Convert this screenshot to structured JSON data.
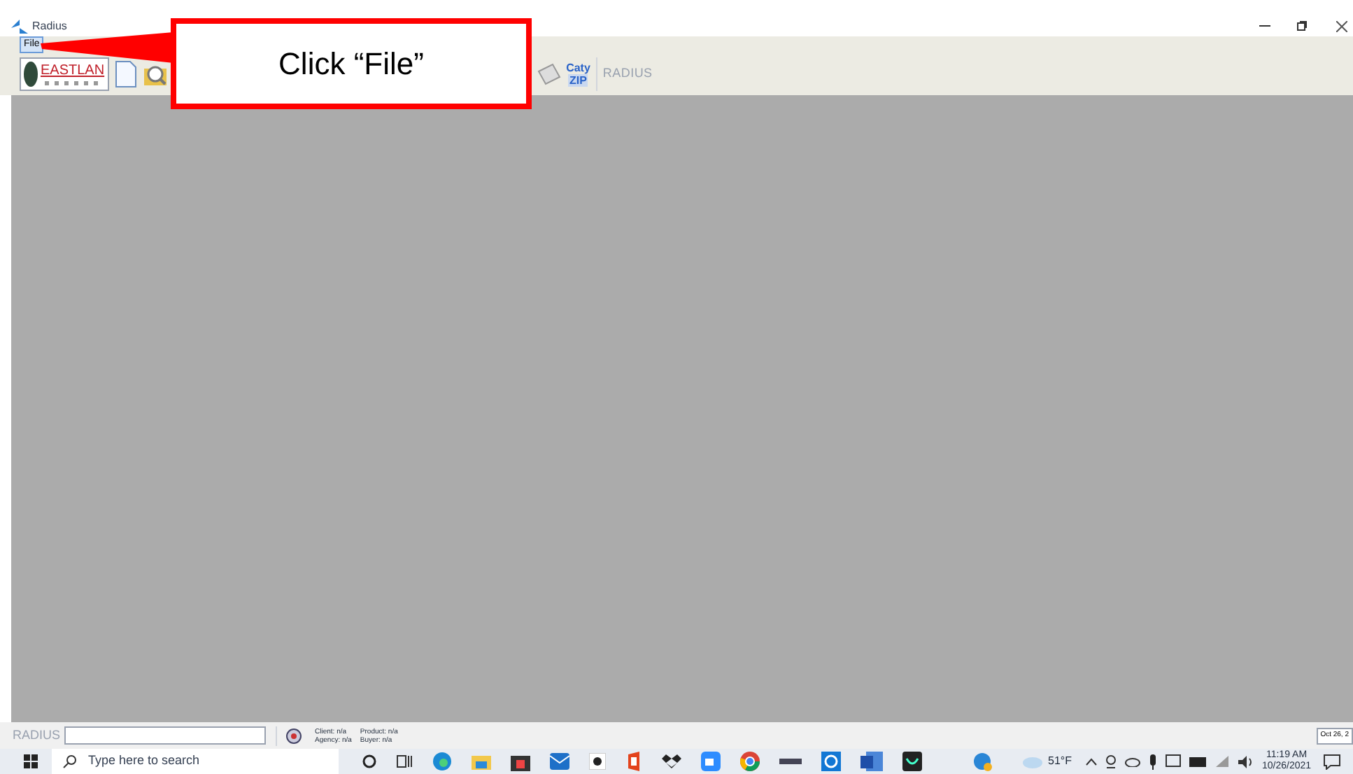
{
  "window": {
    "title": "Radius"
  },
  "menu": [
    {
      "label": "File",
      "selected": true
    }
  ],
  "toolbar": {
    "company_logo": "EASTLAN",
    "zip_button": [
      "Caty",
      "ZIP"
    ],
    "brand_logo": "RADIUS"
  },
  "callout": {
    "text": "Click “File”"
  },
  "status_bar": {
    "brand_logo": "RADIUS",
    "fields": [
      {
        "label": "Client: n/a"
      },
      {
        "label": "Product: n/a"
      },
      {
        "label": "Agency: n/a"
      },
      {
        "label": "Buyer: n/a"
      }
    ],
    "date": "Oct 26, 2"
  },
  "taskbar": {
    "search_placeholder": "Type here to search",
    "weather": "51°F",
    "time": "11:19 AM",
    "date": "10/26/2021"
  }
}
